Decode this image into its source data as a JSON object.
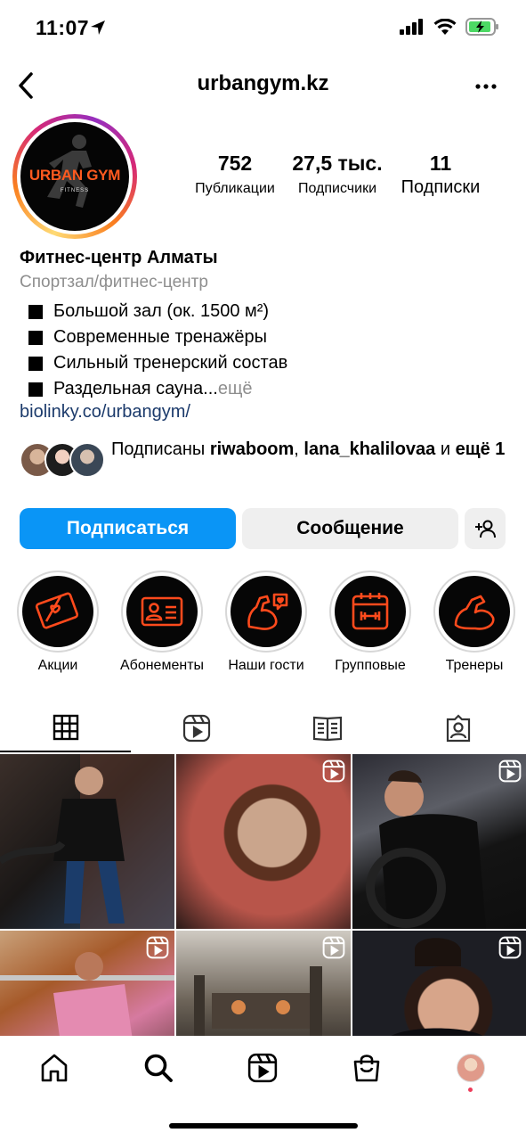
{
  "status_bar": {
    "time": "11:07"
  },
  "header": {
    "username": "urbangym.kz"
  },
  "avatar": {
    "logo_text": "URBAN GYM",
    "logo_sub": "FITNESS"
  },
  "stats": [
    {
      "value": "752",
      "label": "Публикации"
    },
    {
      "value": "27,5 тыс.",
      "label": "Подписчики"
    },
    {
      "value": "11",
      "label": "Подписки"
    }
  ],
  "bio": {
    "name": "Фитнес-центр Алматы",
    "category": "Спортзал/фитнес-центр",
    "lines": [
      "Большой зал (ок. 1500 м²)",
      "Современные тренажёры",
      "Сильный тренерский состав",
      "Раздельная сауна..."
    ],
    "more": " ещё",
    "link": "biolinky.co/urbangym/"
  },
  "followed_by": {
    "prefix": "Подписаны ",
    "user1": "riwaboom",
    "sep": ", ",
    "user2": "lana_khalilovaa",
    "mid": " и ",
    "rest": "ещё 1"
  },
  "buttons": {
    "follow": "Подписаться",
    "message": "Сообщение"
  },
  "highlights": [
    {
      "label": "Акции",
      "icon": "gift-card-icon"
    },
    {
      "label": "Абонементы",
      "icon": "id-card-icon"
    },
    {
      "label": "Наши гости",
      "icon": "flex-arm-heart-icon"
    },
    {
      "label": "Групповые",
      "icon": "calendar-dumbbell-icon"
    },
    {
      "label": "Тренеры",
      "icon": "flex-arm-icon"
    }
  ],
  "colors": {
    "accent": "#0a95f6",
    "highlight_icon": "#ff4a1c",
    "link": "#1b3a6b"
  }
}
